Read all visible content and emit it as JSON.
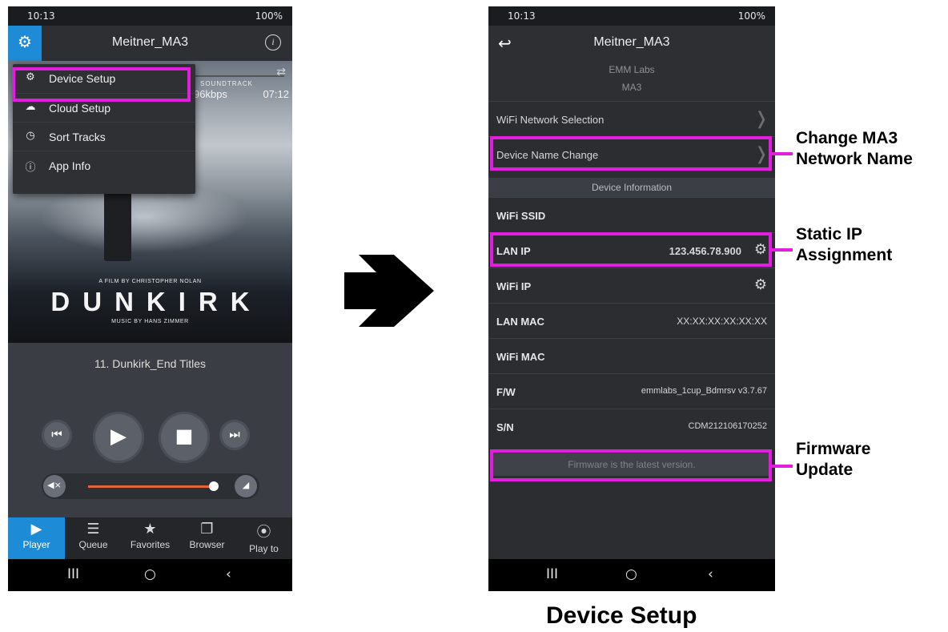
{
  "phone_left": {
    "status": {
      "time": "10:13",
      "right": "100%"
    },
    "topbar_title": "Meitner_MA3",
    "menu_items": [
      {
        "icon": "gear-icon",
        "glyph": "⚙",
        "label": "Device Setup"
      },
      {
        "icon": "cloud-icon",
        "glyph": "☁",
        "label": "Cloud Setup"
      },
      {
        "icon": "clock-icon",
        "glyph": "◷",
        "label": "Sort Tracks"
      },
      {
        "icon": "info-icon",
        "glyph": "ⓘ",
        "label": "App Info"
      }
    ],
    "poster": {
      "track_header": "SOUNDTRACK",
      "bitrate": "96kbps",
      "duration": "07:12",
      "credit": "A FILM BY CHRISTOPHER NOLAN",
      "movie_title": "DUNKIRK",
      "music_credit": "MUSIC BY HANS ZIMMER"
    },
    "now_playing": "11. Dunkirk_End Titles",
    "volume_level": 0.85,
    "tabs": [
      {
        "icon": "play-icon",
        "glyph": "▶",
        "label": "Player",
        "active": true
      },
      {
        "icon": "queue-icon",
        "glyph": "☰",
        "label": "Queue"
      },
      {
        "icon": "favorites-icon",
        "glyph": "★",
        "label": "Favorites"
      },
      {
        "icon": "browser-icon",
        "glyph": "❐",
        "label": "Browser"
      },
      {
        "icon": "play-to-icon",
        "glyph": "⦿",
        "label": "Play to"
      }
    ],
    "nav": {
      "recents": "III",
      "home": "○",
      "back": "‹"
    }
  },
  "phone_right": {
    "status": {
      "time": "10:13",
      "right": "100%"
    },
    "topbar_title": "Meitner_MA3",
    "brand": "EMM Labs",
    "model": "MA3",
    "rows_top": [
      {
        "label": "WiFi Network Selection"
      },
      {
        "label": "Device Name Change"
      }
    ],
    "section_header": "Device Information",
    "info_rows": [
      {
        "label": "WiFi SSID",
        "value": ""
      },
      {
        "label": "LAN IP",
        "value": "123.456.78.900"
      },
      {
        "label": "WiFi IP",
        "value": ""
      },
      {
        "label": "LAN MAC",
        "value": "XX:XX:XX:XX:XX:XX"
      },
      {
        "label": "WiFi MAC",
        "value": ""
      },
      {
        "label": "F/W",
        "value": "emmlabs_1cup_Bdmrsv v3.7.67"
      },
      {
        "label": "S/N",
        "value": "CDM212106170252"
      }
    ],
    "firmware_status": "Firmware is the latest version.",
    "nav": {
      "recents": "III",
      "home": "○",
      "back": "‹"
    }
  },
  "annotations": {
    "network_name_1": "Change MA3",
    "network_name_2": "Network Name",
    "static_ip_1": "Static IP",
    "static_ip_2": "Assignment",
    "firmware_1": "Firmware",
    "firmware_2": "Update"
  },
  "caption": "Device Setup",
  "colors": {
    "highlight": "#e21de0",
    "accent": "#1e8bd6",
    "volume": "#e0663a"
  }
}
